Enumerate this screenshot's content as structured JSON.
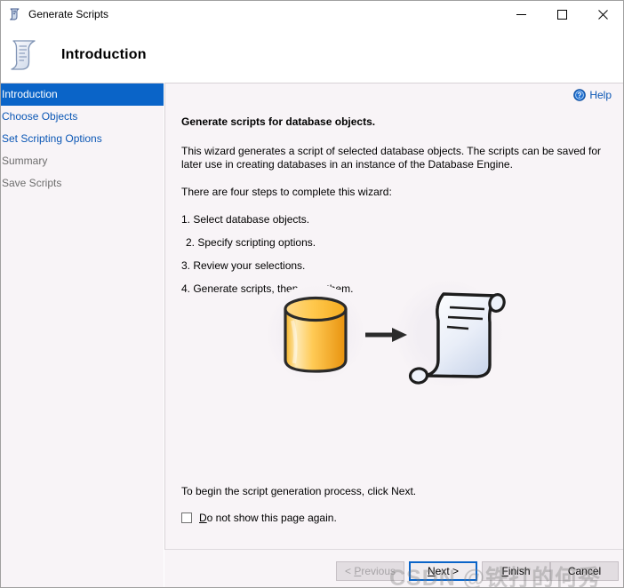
{
  "window": {
    "title": "Generate Scripts",
    "icon": "script-scroll-icon",
    "controls": {
      "minimize": "minimize-icon",
      "maximize": "maximize-icon",
      "close": "close-icon"
    }
  },
  "header": {
    "title": "Introduction",
    "icon": "script-scroll-icon"
  },
  "sidebar": {
    "items": [
      {
        "label": "Introduction",
        "state": "selected"
      },
      {
        "label": "Choose Objects",
        "state": "link"
      },
      {
        "label": "Set Scripting Options",
        "state": "link"
      },
      {
        "label": "Summary",
        "state": "disabled"
      },
      {
        "label": "Save Scripts",
        "state": "disabled"
      }
    ]
  },
  "help": {
    "label": "Help",
    "icon": "help-question-icon"
  },
  "main": {
    "heading": "Generate scripts for database objects.",
    "intro": "This wizard generates a script of selected database objects. The scripts can be saved for later use in creating databases in an instance of the Database Engine.",
    "steps_intro": "There are four steps to complete this wizard:",
    "steps": [
      "1. Select database objects.",
      " 2. Specify scripting options.",
      "3. Review your selections.",
      "4. Generate scripts, then save them."
    ],
    "begin_text": "To begin the script generation process, click Next.",
    "checkbox": {
      "label": "Do not show this page again.",
      "accelerator": "D",
      "checked": false
    },
    "illustration": {
      "source_icon": "database-cylinder-icon",
      "arrow_icon": "arrow-right-icon",
      "target_icon": "script-scroll-large-icon"
    }
  },
  "footer": {
    "buttons": [
      {
        "id": "previous",
        "label": "< Previous",
        "accelerator": "P",
        "state": "disabled"
      },
      {
        "id": "next",
        "label": "Next >",
        "accelerator": "N",
        "state": "focused"
      },
      {
        "id": "finish",
        "label": "Finish",
        "accelerator": "F",
        "state": "normal"
      },
      {
        "id": "cancel",
        "label": "Cancel",
        "accelerator": "",
        "state": "normal"
      }
    ]
  },
  "watermark": {
    "text": "CSDN @铁打的何秀"
  },
  "colors": {
    "accent_blue": "#0a64c8",
    "link_blue": "#0b57b5",
    "panel_bg": "#f8f4f7",
    "button_bg": "#e2dde1",
    "disabled_text": "#a6a3a6"
  }
}
